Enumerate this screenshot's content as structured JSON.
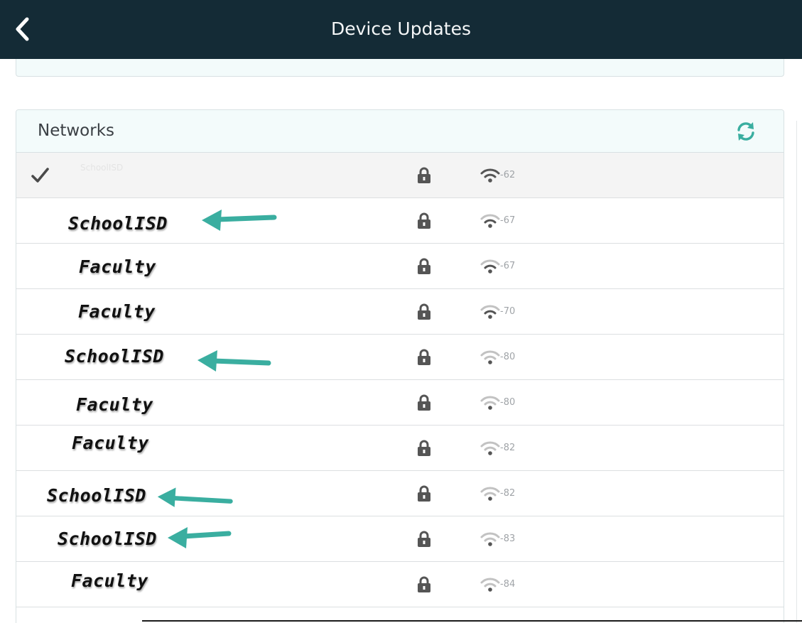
{
  "header": {
    "title": "Device Updates"
  },
  "networks": {
    "title": "Networks",
    "rows": [
      {
        "ssid": "SchoolISD",
        "rssi": "-67"
      },
      {
        "ssid": "Faculty",
        "rssi": "-67"
      },
      {
        "ssid": "Faculty",
        "rssi": "-70"
      },
      {
        "ssid": "SchoolISD",
        "rssi": "-80"
      },
      {
        "ssid": "Faculty",
        "rssi": "-80"
      },
      {
        "ssid": "Faculty",
        "rssi": "-82"
      },
      {
        "ssid": "SchoolISD",
        "rssi": "-82"
      },
      {
        "ssid": "SchoolISD",
        "rssi": "-83"
      },
      {
        "ssid": "Faculty",
        "rssi": "-84"
      }
    ],
    "connected": {
      "ssid": "SchoolISD",
      "rssi": "-62"
    }
  },
  "icons": {
    "back": "chevron-left-icon",
    "refresh": "refresh-icon",
    "check": "checkmark-icon",
    "lock": "lock-icon",
    "wifi": "wifi-signal-icon",
    "annotation": "arrow-left-icon"
  },
  "colors": {
    "header_bg": "#142b36",
    "accent": "#3aaea0",
    "panel_bg": "#f3fbfb",
    "connected_row_bg": "#f4f4f4"
  }
}
